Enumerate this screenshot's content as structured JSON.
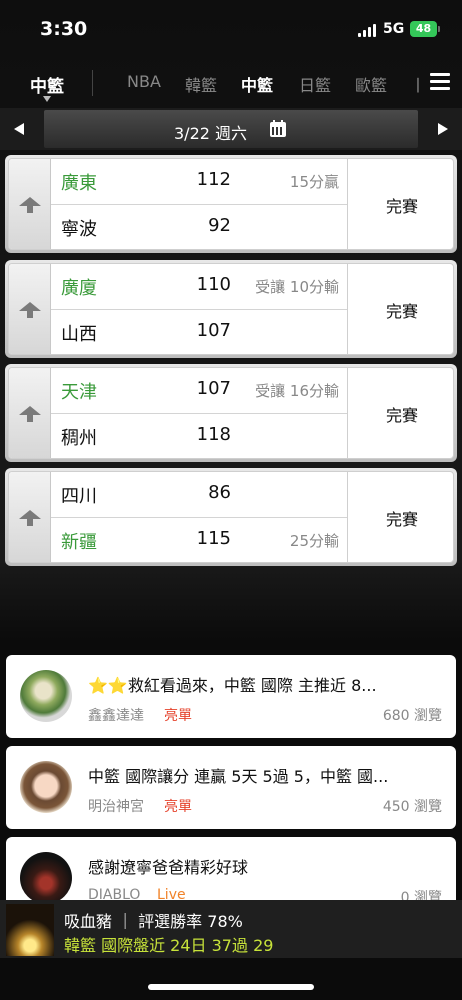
{
  "status_bar": {
    "time": "3:30",
    "network": "5G",
    "battery": "48"
  },
  "league_nav": {
    "current": "中籃",
    "tabs": [
      "NBA",
      "韓籃",
      "中籃",
      "日籃",
      "歐籃",
      "丨"
    ],
    "active_tab": "中籃"
  },
  "date_bar": {
    "date": "3/22 週六"
  },
  "games": [
    {
      "home": "廣東",
      "home_score": "112",
      "home_note": "15分贏",
      "away": "寧波",
      "away_score": "92",
      "away_note": "",
      "status": "完賽",
      "home_green": true,
      "away_green": false
    },
    {
      "home": "廣廈",
      "home_score": "110",
      "home_note": "受讓 10分輸",
      "away": "山西",
      "away_score": "107",
      "away_note": "",
      "status": "完賽",
      "home_green": true,
      "away_green": false
    },
    {
      "home": "天津",
      "home_score": "107",
      "home_note": "受讓 16分輸",
      "away": "稠州",
      "away_score": "118",
      "away_note": "",
      "status": "完賽",
      "home_green": true,
      "away_green": false
    },
    {
      "home": "四川",
      "home_score": "86",
      "home_note": "",
      "away": "新疆",
      "away_score": "115",
      "away_note": "25分輸",
      "status": "完賽",
      "home_green": false,
      "away_green": true
    }
  ],
  "articles": [
    {
      "title": "⭐⭐救紅看過來，中籃 國際 主推近 8...",
      "author": "鑫鑫達達",
      "tag": "亮單",
      "views": "680 瀏覽"
    },
    {
      "title": "中籃 國際讓分 連贏 5天 5過 5，中籃 國...",
      "author": "明治神宮",
      "tag": "亮單",
      "views": "450 瀏覽"
    },
    {
      "title": "感謝遼寧爸爸精彩好球",
      "author": "DIABLO",
      "tag": "Live",
      "views": "0 瀏覽"
    }
  ],
  "banner": {
    "line1": "吸血豬 ｜ 評選勝率 78%",
    "line2": "韓籃 國際盤近 24日 37過 29"
  },
  "colors": {
    "green_team": "#3a9a3a",
    "tag_red": "#e5422b",
    "tag_live": "#f0832a",
    "banner_highlight": "#c7e23a"
  }
}
